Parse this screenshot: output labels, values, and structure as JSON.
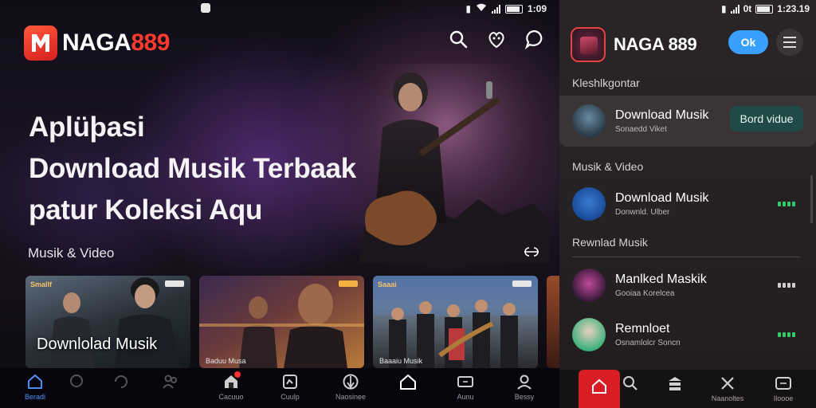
{
  "left_screen": {
    "status_bar": {
      "time": "1:09"
    },
    "brand": {
      "name_white": "NAGA",
      "name_red": "889"
    },
    "hero": {
      "line1": "Aplüþasi",
      "line2": "Download Musik Terbaak",
      "line3": "patur Koleksi Aqu"
    },
    "section": {
      "title": "Musik & Video",
      "more_icon": "double-chevron-icon"
    },
    "cards": [
      {
        "tag": "Smallf",
        "overlay": "Downlolad Musik",
        "footer": ""
      },
      {
        "tag": "",
        "overlay": "",
        "footer": "Baduu Musa"
      },
      {
        "tag": "Saaai",
        "overlay": "",
        "footer": "Baaaiu Musik"
      }
    ],
    "bottom_nav": [
      {
        "label": "Beradi",
        "icon": "home-icon",
        "active": true
      },
      {
        "label": "",
        "icon": "chat-icon",
        "active": false
      },
      {
        "label": "",
        "icon": "refresh-icon",
        "active": false
      },
      {
        "label": "",
        "icon": "people-icon",
        "active": false
      },
      {
        "label": "Cacuuo",
        "icon": "store-icon",
        "active": false
      },
      {
        "label": "Cuulp",
        "icon": "frame-icon",
        "active": false
      },
      {
        "label": "Naosinee",
        "icon": "compass-icon",
        "active": false
      },
      {
        "label": "",
        "icon": "house-outline-icon",
        "active": false
      },
      {
        "label": "Aunu",
        "icon": "tv-icon",
        "active": false
      },
      {
        "label": "Bessy",
        "icon": "profile-icon",
        "active": false
      }
    ]
  },
  "right_screen": {
    "status_bar": {
      "time": "1:23.19",
      "carrier": "0t"
    },
    "header": {
      "title": "NAGA 889",
      "ok_label": "Ok"
    },
    "featured_label": "Kleshlkgontar",
    "featured_item": {
      "title": "Download Musik",
      "subtitle": "Sonaedd Viket",
      "button": "Bord vidue"
    },
    "section1_label": "Musik & Video",
    "item1": {
      "title": "Download Musik",
      "subtitle": "Donwnld. Ulber"
    },
    "section2_label": "Rewnlad Musik",
    "item2": {
      "title": "Manlked Maskik",
      "subtitle": "Gooiaa Korelcea"
    },
    "item3": {
      "title": "Remnloet",
      "subtitle": "Osnamlolcr Soncn"
    },
    "bottom_nav": [
      {
        "label": "",
        "icon": "home-icon",
        "active": true
      },
      {
        "label": "",
        "icon": "search-icon",
        "active": false
      },
      {
        "label": "",
        "icon": "stack-icon",
        "active": false
      },
      {
        "label": "Naanoltes",
        "icon": "close-x-icon",
        "active": false
      },
      {
        "label": "Iloooe",
        "icon": "tv-icon",
        "active": false
      }
    ]
  },
  "colors": {
    "brand_red": "#ff3b2f",
    "ok_blue": "#3aa0ff",
    "button_teal": "#1f4a48",
    "bar_green": "#37c86a"
  }
}
